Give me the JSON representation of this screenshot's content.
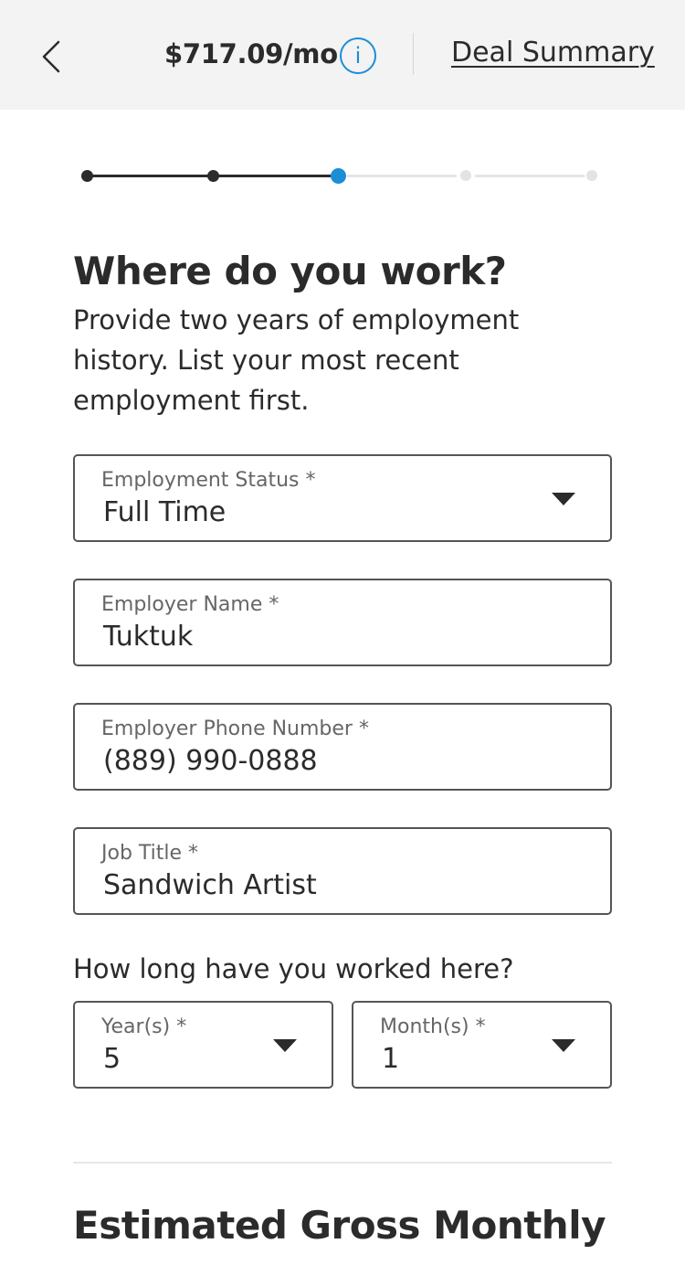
{
  "header": {
    "price": "$717.09/mo",
    "info_icon": "i",
    "deal_summary": "Deal Summary"
  },
  "stepper": {
    "total_steps": 5,
    "current_step": 3,
    "colors": {
      "done": "#2b2b2b",
      "current": "#1b8ed6",
      "todo": "#e6e6e6"
    }
  },
  "main": {
    "title": "Where do you work?",
    "subtitle": "Provide two years of employment history. List your most recent employment first.",
    "fields": {
      "employment_status": {
        "label": "Employment Status *",
        "value": "Full Time"
      },
      "employer_name": {
        "label": "Employer Name *",
        "value": "Tuktuk"
      },
      "employer_phone": {
        "label": "Employer Phone Number *",
        "value": "(889) 990-0888"
      },
      "job_title": {
        "label": "Job Title *",
        "value": "Sandwich Artist"
      }
    },
    "duration_question": "How long have you worked here?",
    "years": {
      "label": "Year(s) *",
      "value": "5"
    },
    "months": {
      "label": "Month(s) *",
      "value": "1"
    },
    "next_section_title": "Estimated Gross Monthly"
  },
  "icons": {
    "back": "chevron-left-icon",
    "info": "info-icon",
    "dropdown": "caret-down-icon"
  }
}
